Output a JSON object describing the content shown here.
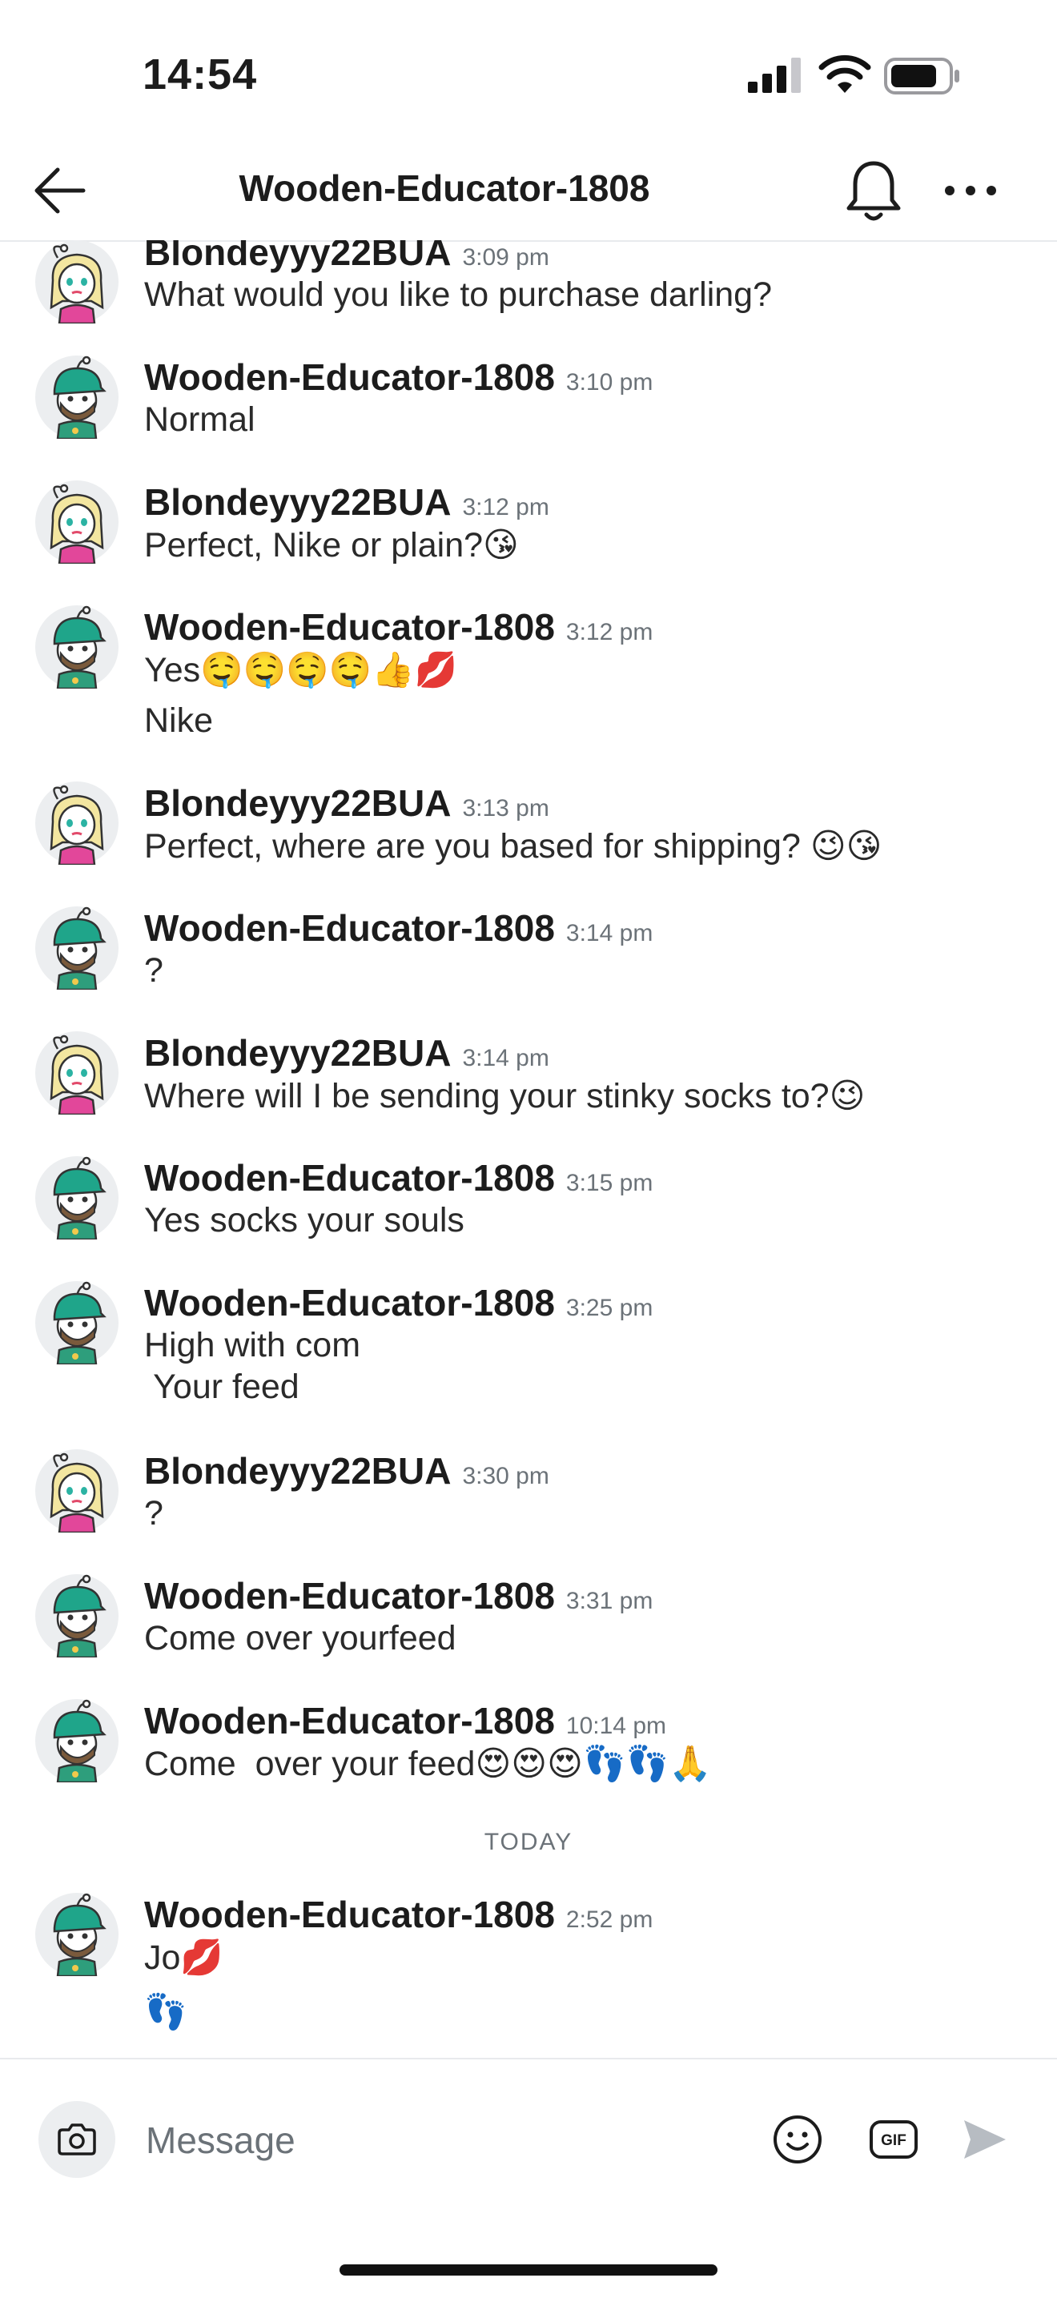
{
  "status_bar": {
    "time": "14:54"
  },
  "header": {
    "title": "Wooden-Educator-1808"
  },
  "messages": [
    {
      "sender": "Blondeyyy22BUA",
      "time": "3:09 pm",
      "lines": [
        "What would you like to purchase darling?"
      ]
    },
    {
      "sender": "Wooden-Educator-1808",
      "time": "3:10 pm",
      "lines": [
        "Normal"
      ]
    },
    {
      "sender": "Blondeyyy22BUA",
      "time": "3:12 pm",
      "lines": [
        "Perfect, Nike or plain?😘"
      ]
    },
    {
      "sender": "Wooden-Educator-1808",
      "time": "3:12 pm",
      "lines": [
        "Yes🤤🤤🤤🤤👍💋",
        "Nike"
      ]
    },
    {
      "sender": "Blondeyyy22BUA",
      "time": "3:13 pm",
      "lines": [
        "Perfect, where are you based for shipping? 😉😘"
      ]
    },
    {
      "sender": "Wooden-Educator-1808",
      "time": "3:14 pm",
      "lines": [
        "?"
      ]
    },
    {
      "sender": "Blondeyyy22BUA",
      "time": "3:14 pm",
      "lines": [
        "Where will I be sending your stinky socks to?😉"
      ]
    },
    {
      "sender": "Wooden-Educator-1808",
      "time": "3:15 pm",
      "lines": [
        "Yes socks your souls"
      ]
    },
    {
      "sender": "Wooden-Educator-1808",
      "time": "3:25 pm",
      "lines": [
        "High with com",
        " Your feed"
      ]
    },
    {
      "sender": "Blondeyyy22BUA",
      "time": "3:30 pm",
      "lines": [
        "?"
      ]
    },
    {
      "sender": "Wooden-Educator-1808",
      "time": "3:31 pm",
      "lines": [
        "Come over yourfeed"
      ]
    },
    {
      "sender": "Wooden-Educator-1808",
      "time": "10:14 pm",
      "lines": [
        "Come  over your feed😍😍😍👣👣🙏"
      ]
    },
    {
      "sender": "Wooden-Educator-1808",
      "time": "2:52 pm",
      "lines": [
        "Jo💋",
        "👣"
      ]
    }
  ],
  "divider": {
    "today": "TODAY"
  },
  "composer": {
    "placeholder": "Message",
    "gif_label": "GIF"
  },
  "icons": {
    "back": "arrow-left-icon",
    "bell": "bell-icon",
    "more": "more-horizontal-icon",
    "camera": "camera-icon",
    "emoji": "emoji-smile-icon",
    "gif": "gif-icon",
    "send": "send-icon"
  },
  "colors": {
    "text": "#1c1c1c",
    "muted": "#6b7278",
    "avatar_blonde_hair": "#f3e6a0",
    "avatar_blonde_shirt": "#e2479a",
    "avatar_educator_hat": "#1fa58a",
    "avatar_educator_shirt": "#2e9e7c",
    "send_disabled": "#b7bcc2"
  }
}
